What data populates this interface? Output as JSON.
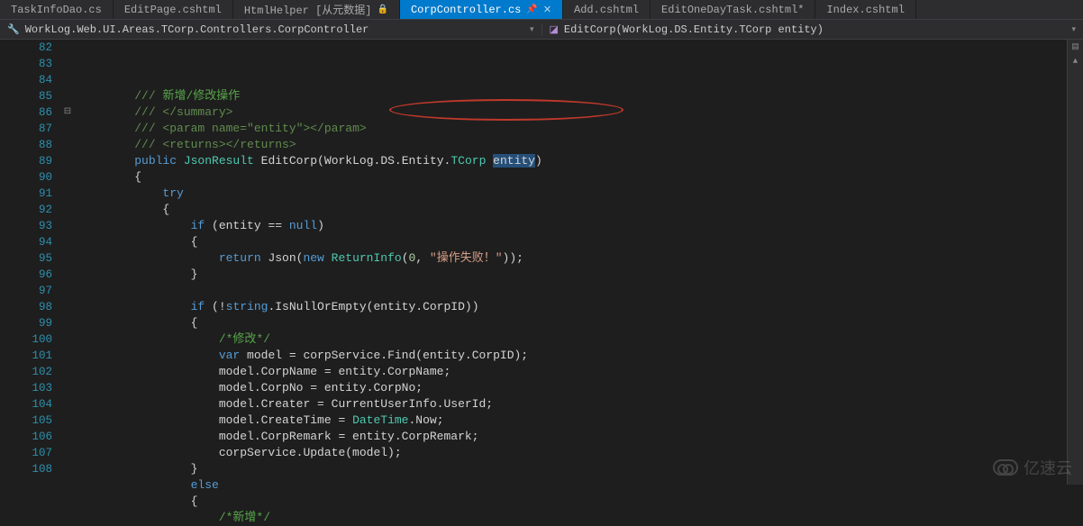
{
  "tabs": [
    {
      "label": "TaskInfoDao.cs",
      "active": false
    },
    {
      "label": "EditPage.cshtml",
      "active": false
    },
    {
      "label": "HtmlHelper [从元数据]",
      "active": false,
      "locked": true
    },
    {
      "label": "CorpController.cs",
      "active": true,
      "pinned": true
    },
    {
      "label": "Add.cshtml",
      "active": false
    },
    {
      "label": "EditOneDayTask.cshtml*",
      "active": false
    },
    {
      "label": "Index.cshtml",
      "active": false
    }
  ],
  "breadcrumb": {
    "left_icon": "wrench",
    "left": "WorkLog.Web.UI.Areas.TCorp.Controllers.CorpController",
    "right_icon": "cube",
    "right": "EditCorp(WorkLog.DS.Entity.TCorp entity)"
  },
  "line_start": 82,
  "line_end": 108,
  "fold_line": 86,
  "code_lines": [
    {
      "n": 82,
      "segs": [
        {
          "t": "/// ",
          "c": "c-xmlcomment"
        },
        {
          "t": "新增/修改操作",
          "c": "c-comment"
        }
      ],
      "indent": 1
    },
    {
      "n": 83,
      "segs": [
        {
          "t": "/// </summary>",
          "c": "c-xmlcomment"
        }
      ],
      "indent": 1
    },
    {
      "n": 84,
      "segs": [
        {
          "t": "/// <param name=\"",
          "c": "c-xmlcomment"
        },
        {
          "t": "entity",
          "c": "c-xmlcomment"
        },
        {
          "t": "\"></param>",
          "c": "c-xmlcomment"
        }
      ],
      "indent": 1
    },
    {
      "n": 85,
      "segs": [
        {
          "t": "/// <returns></returns>",
          "c": "c-xmlcomment"
        }
      ],
      "indent": 1
    },
    {
      "n": 86,
      "segs": [
        {
          "t": "public ",
          "c": "c-keyword"
        },
        {
          "t": "JsonResult ",
          "c": "c-type"
        },
        {
          "t": "EditCorp",
          "c": "c-text"
        },
        {
          "t": "(",
          "c": "c-text"
        },
        {
          "t": "WorkLog",
          "c": "c-text"
        },
        {
          "t": ".",
          "c": "c-text"
        },
        {
          "t": "DS",
          "c": "c-text"
        },
        {
          "t": ".",
          "c": "c-text"
        },
        {
          "t": "Entity",
          "c": "c-text"
        },
        {
          "t": ".",
          "c": "c-text"
        },
        {
          "t": "TCorp ",
          "c": "c-type"
        },
        {
          "t": "entity",
          "c": "c-text",
          "hl": true
        },
        {
          "t": ")",
          "c": "c-text"
        }
      ],
      "indent": 1
    },
    {
      "n": 87,
      "segs": [
        {
          "t": "{",
          "c": "c-text"
        }
      ],
      "indent": 1
    },
    {
      "n": 88,
      "segs": [
        {
          "t": "try",
          "c": "c-keyword"
        }
      ],
      "indent": 2
    },
    {
      "n": 89,
      "segs": [
        {
          "t": "{",
          "c": "c-text"
        }
      ],
      "indent": 2
    },
    {
      "n": 90,
      "segs": [
        {
          "t": "if ",
          "c": "c-keyword"
        },
        {
          "t": "(entity == ",
          "c": "c-text"
        },
        {
          "t": "null",
          "c": "c-keyword"
        },
        {
          "t": ")",
          "c": "c-text"
        }
      ],
      "indent": 3
    },
    {
      "n": 91,
      "segs": [
        {
          "t": "{",
          "c": "c-text"
        }
      ],
      "indent": 3
    },
    {
      "n": 92,
      "segs": [
        {
          "t": "return ",
          "c": "c-keyword"
        },
        {
          "t": "Json(",
          "c": "c-text"
        },
        {
          "t": "new ",
          "c": "c-keyword"
        },
        {
          "t": "ReturnInfo",
          "c": "c-type"
        },
        {
          "t": "(",
          "c": "c-text"
        },
        {
          "t": "0",
          "c": "c-num"
        },
        {
          "t": ", ",
          "c": "c-text"
        },
        {
          "t": "\"操作失败！\"",
          "c": "c-string"
        },
        {
          "t": "));",
          "c": "c-text"
        }
      ],
      "indent": 4
    },
    {
      "n": 93,
      "segs": [
        {
          "t": "}",
          "c": "c-text"
        }
      ],
      "indent": 3
    },
    {
      "n": 94,
      "segs": [],
      "indent": 0
    },
    {
      "n": 95,
      "segs": [
        {
          "t": "if ",
          "c": "c-keyword"
        },
        {
          "t": "(!",
          "c": "c-text"
        },
        {
          "t": "string",
          "c": "c-keyword"
        },
        {
          "t": ".IsNullOrEmpty(entity.CorpID))",
          "c": "c-text"
        }
      ],
      "indent": 3
    },
    {
      "n": 96,
      "segs": [
        {
          "t": "{",
          "c": "c-text"
        }
      ],
      "indent": 3
    },
    {
      "n": 97,
      "segs": [
        {
          "t": "/*修改*/",
          "c": "c-comment"
        }
      ],
      "indent": 4
    },
    {
      "n": 98,
      "segs": [
        {
          "t": "var ",
          "c": "c-keyword"
        },
        {
          "t": "model = corpService.Find(entity.CorpID);",
          "c": "c-text"
        }
      ],
      "indent": 4
    },
    {
      "n": 99,
      "segs": [
        {
          "t": "model.CorpName = entity.CorpName;",
          "c": "c-text"
        }
      ],
      "indent": 4
    },
    {
      "n": 100,
      "segs": [
        {
          "t": "model.CorpNo = entity.CorpNo;",
          "c": "c-text"
        }
      ],
      "indent": 4
    },
    {
      "n": 101,
      "segs": [
        {
          "t": "model.Creater = CurrentUserInfo.UserId;",
          "c": "c-text"
        }
      ],
      "indent": 4
    },
    {
      "n": 102,
      "segs": [
        {
          "t": "model.CreateTime = ",
          "c": "c-text"
        },
        {
          "t": "DateTime",
          "c": "c-type"
        },
        {
          "t": ".Now;",
          "c": "c-text"
        }
      ],
      "indent": 4
    },
    {
      "n": 103,
      "segs": [
        {
          "t": "model.CorpRemark = entity.CorpRemark;",
          "c": "c-text"
        }
      ],
      "indent": 4
    },
    {
      "n": 104,
      "segs": [
        {
          "t": "corpService.Update(model);",
          "c": "c-text"
        }
      ],
      "indent": 4
    },
    {
      "n": 105,
      "segs": [
        {
          "t": "}",
          "c": "c-text"
        }
      ],
      "indent": 3
    },
    {
      "n": 106,
      "segs": [
        {
          "t": "else",
          "c": "c-keyword"
        }
      ],
      "indent": 3
    },
    {
      "n": 107,
      "segs": [
        {
          "t": "{",
          "c": "c-text"
        }
      ],
      "indent": 3
    },
    {
      "n": 108,
      "segs": [
        {
          "t": "/*新增*/",
          "c": "c-comment"
        }
      ],
      "indent": 4
    }
  ],
  "watermark": "亿速云"
}
